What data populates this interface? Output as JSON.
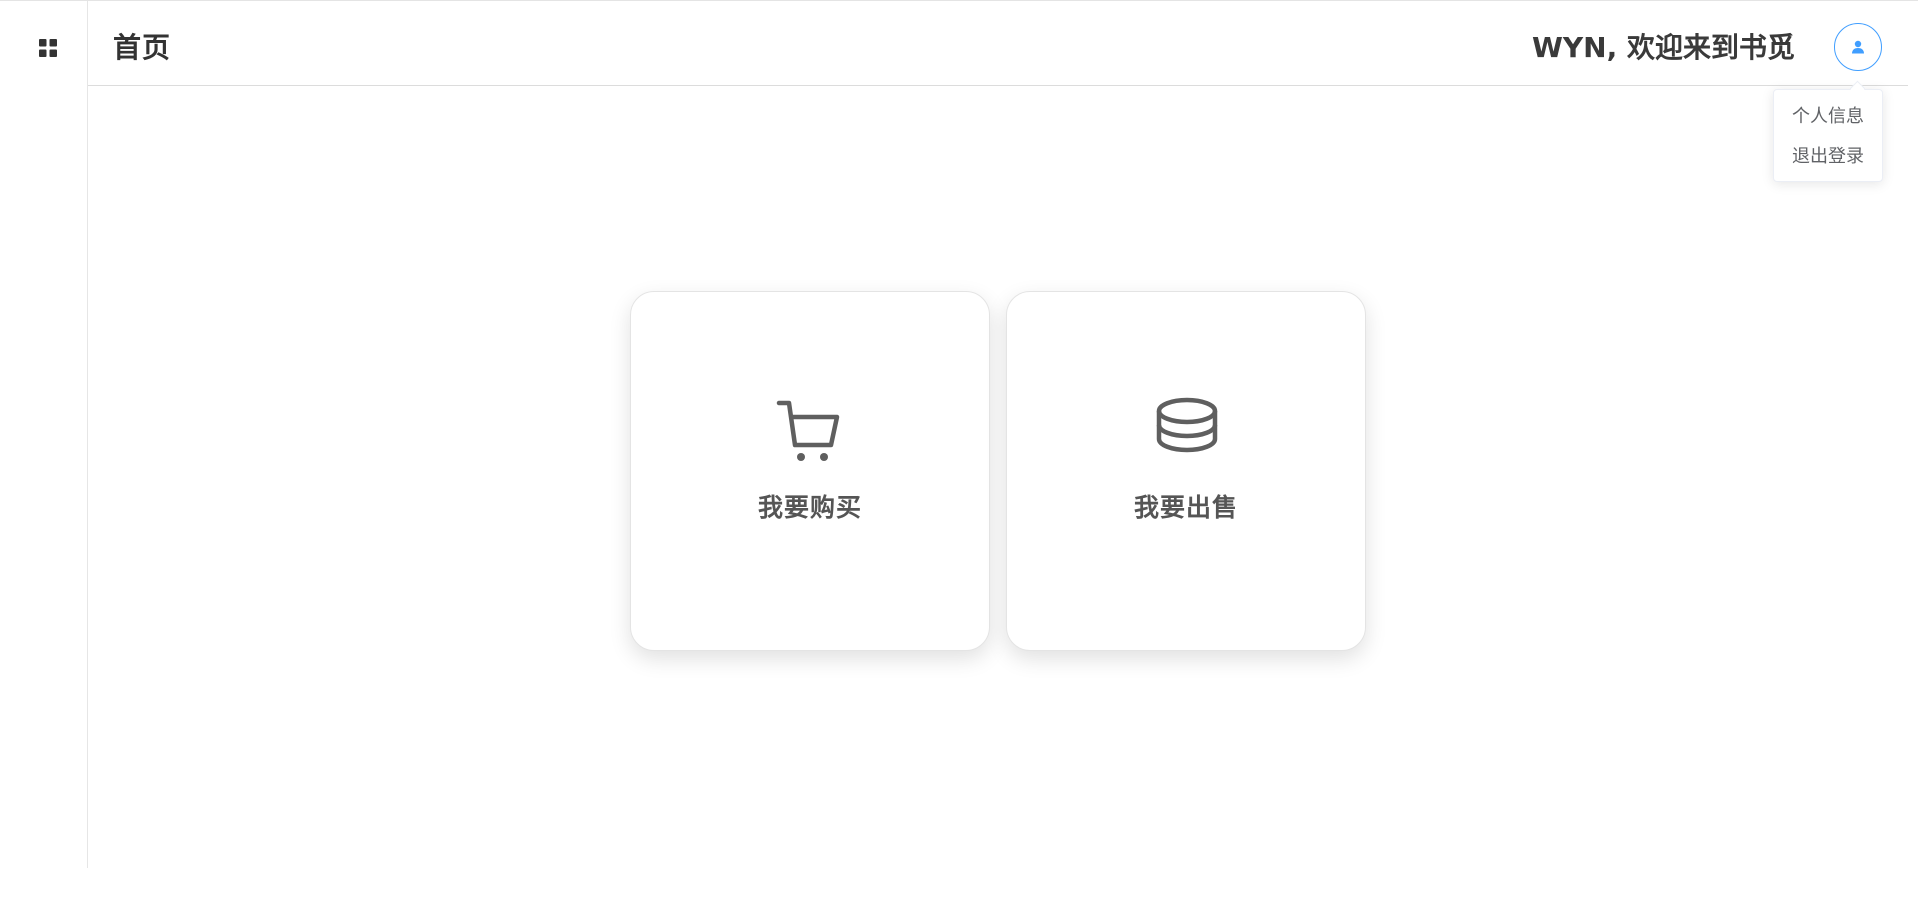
{
  "header": {
    "title": "首页",
    "welcome": "WYN, 欢迎来到书觅"
  },
  "user_menu": {
    "items": [
      {
        "label": "个人信息"
      },
      {
        "label": "退出登录"
      }
    ]
  },
  "cards": {
    "buy": {
      "label": "我要购买",
      "icon": "cart-icon"
    },
    "sell": {
      "label": "我要出售",
      "icon": "coins-icon"
    }
  },
  "icons": {
    "sidebar_toggle": "grid-icon",
    "avatar": "user-icon"
  },
  "colors": {
    "accent": "#409eff",
    "icon_gray": "#5f5f5f",
    "text_dark": "#333333",
    "menu_text": "#606266"
  }
}
